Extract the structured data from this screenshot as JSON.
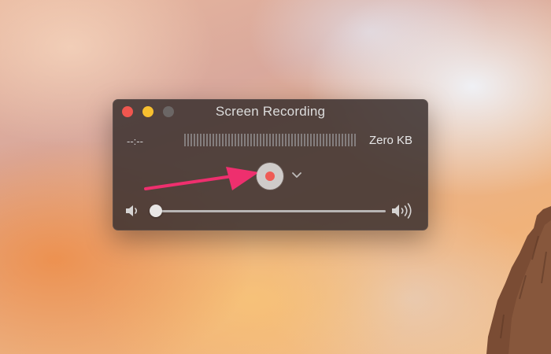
{
  "window": {
    "title": "Screen Recording",
    "time": "--:--",
    "file_size": "Zero KB"
  },
  "controls": {
    "record_button_icon": "record-icon",
    "options_icon": "chevron-down-icon",
    "volume_low_icon": "speaker-low-icon",
    "volume_high_icon": "speaker-high-icon",
    "volume_level": 0
  },
  "annotation": {
    "arrow_color": "#ee2f6e"
  },
  "colors": {
    "close": "#f0564f",
    "minimize": "#f7bf2f",
    "zoom": "#6b6665",
    "record_dot": "#ef5b55"
  }
}
